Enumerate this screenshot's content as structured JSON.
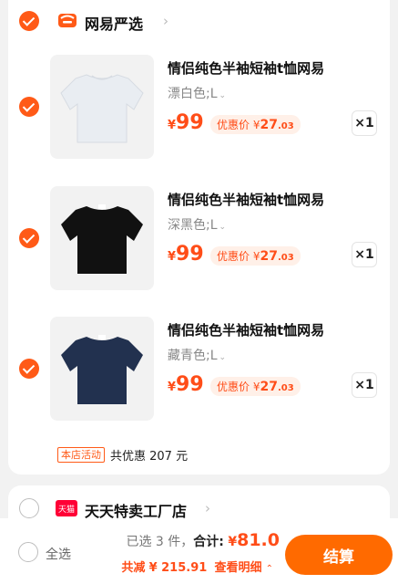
{
  "store1": {
    "name": "网易严选",
    "items": [
      {
        "title": "情侣纯色半袖短袖t恤网易",
        "spec": "漂白色;L",
        "yen": "¥",
        "price": "99",
        "promo_label": "优惠价",
        "promo_yen": "¥",
        "promo_int": "27",
        "promo_dec": ".03",
        "qty": "×1"
      },
      {
        "title": "情侣纯色半袖短袖t恤网易",
        "spec": "深黑色;L",
        "yen": "¥",
        "price": "99",
        "promo_label": "优惠价",
        "promo_yen": "¥",
        "promo_int": "27",
        "promo_dec": ".03",
        "qty": "×1"
      },
      {
        "title": "情侣纯色半袖短袖t恤网易",
        "spec": "藏青色;L",
        "yen": "¥",
        "price": "99",
        "promo_label": "优惠价",
        "promo_yen": "¥",
        "promo_int": "27",
        "promo_dec": ".03",
        "qty": "×1"
      }
    ],
    "activity_tag": "本店活动",
    "activity_text": "共优惠 207 元"
  },
  "store2": {
    "name": "天天特卖工厂店",
    "badge": "天猫"
  },
  "footer": {
    "select_all": "全选",
    "selected_count": "已选 3 件，",
    "total_label": "合计:",
    "total_yen": "¥",
    "total_value": "81.0",
    "discount_label": "共减",
    "discount_value": "¥ 215.91",
    "detail_link": "查看明细",
    "checkout": "结算"
  },
  "colors": {
    "accent": "#ff5a17",
    "price": "#ff4d18",
    "checkout": "#ff6a00"
  },
  "tshirt_colors": [
    "#e9edf2",
    "#111111",
    "#22314f"
  ]
}
